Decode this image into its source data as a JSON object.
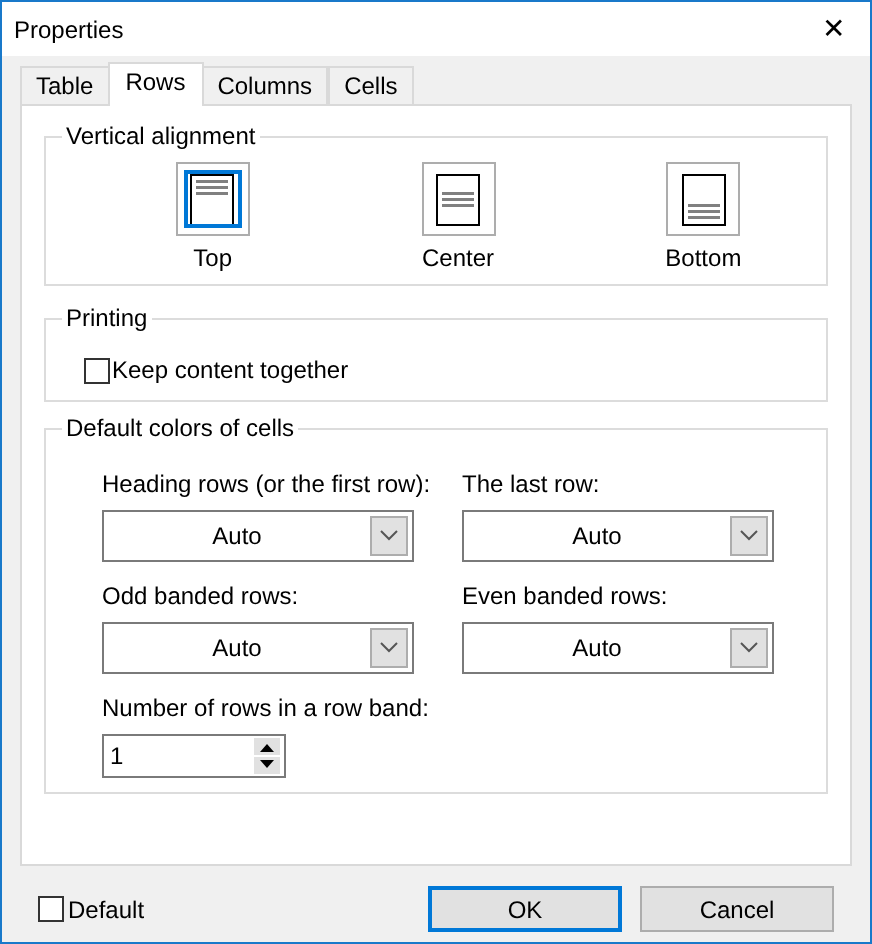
{
  "window": {
    "title": "Properties",
    "close": "✕"
  },
  "tabs": [
    {
      "label": "Table",
      "selected": false
    },
    {
      "label": "Rows",
      "selected": true
    },
    {
      "label": "Columns",
      "selected": false
    },
    {
      "label": "Cells",
      "selected": false
    }
  ],
  "vertical_alignment": {
    "title": "Vertical alignment",
    "options": [
      {
        "label": "Top",
        "kind": "top",
        "selected": true
      },
      {
        "label": "Center",
        "kind": "center",
        "selected": false
      },
      {
        "label": "Bottom",
        "kind": "bottom",
        "selected": false
      }
    ]
  },
  "printing": {
    "title": "Printing",
    "checkbox": {
      "label": "Keep content together",
      "checked": false
    }
  },
  "default_colors": {
    "title": "Default colors of cells",
    "dropdowns": [
      {
        "label": "Heading rows (or the first row):",
        "value": "Auto"
      },
      {
        "label": "The last row:",
        "value": "Auto"
      },
      {
        "label": "Odd banded rows:",
        "value": "Auto"
      },
      {
        "label": "Even banded rows:",
        "value": "Auto"
      }
    ],
    "spinner": {
      "label": "Number of rows in a row band:",
      "value": "1"
    }
  },
  "footer": {
    "checkbox": {
      "label": "Default",
      "checked": false
    },
    "buttons": [
      {
        "label": "OK",
        "focused": true
      },
      {
        "label": "Cancel",
        "focused": false
      }
    ]
  }
}
